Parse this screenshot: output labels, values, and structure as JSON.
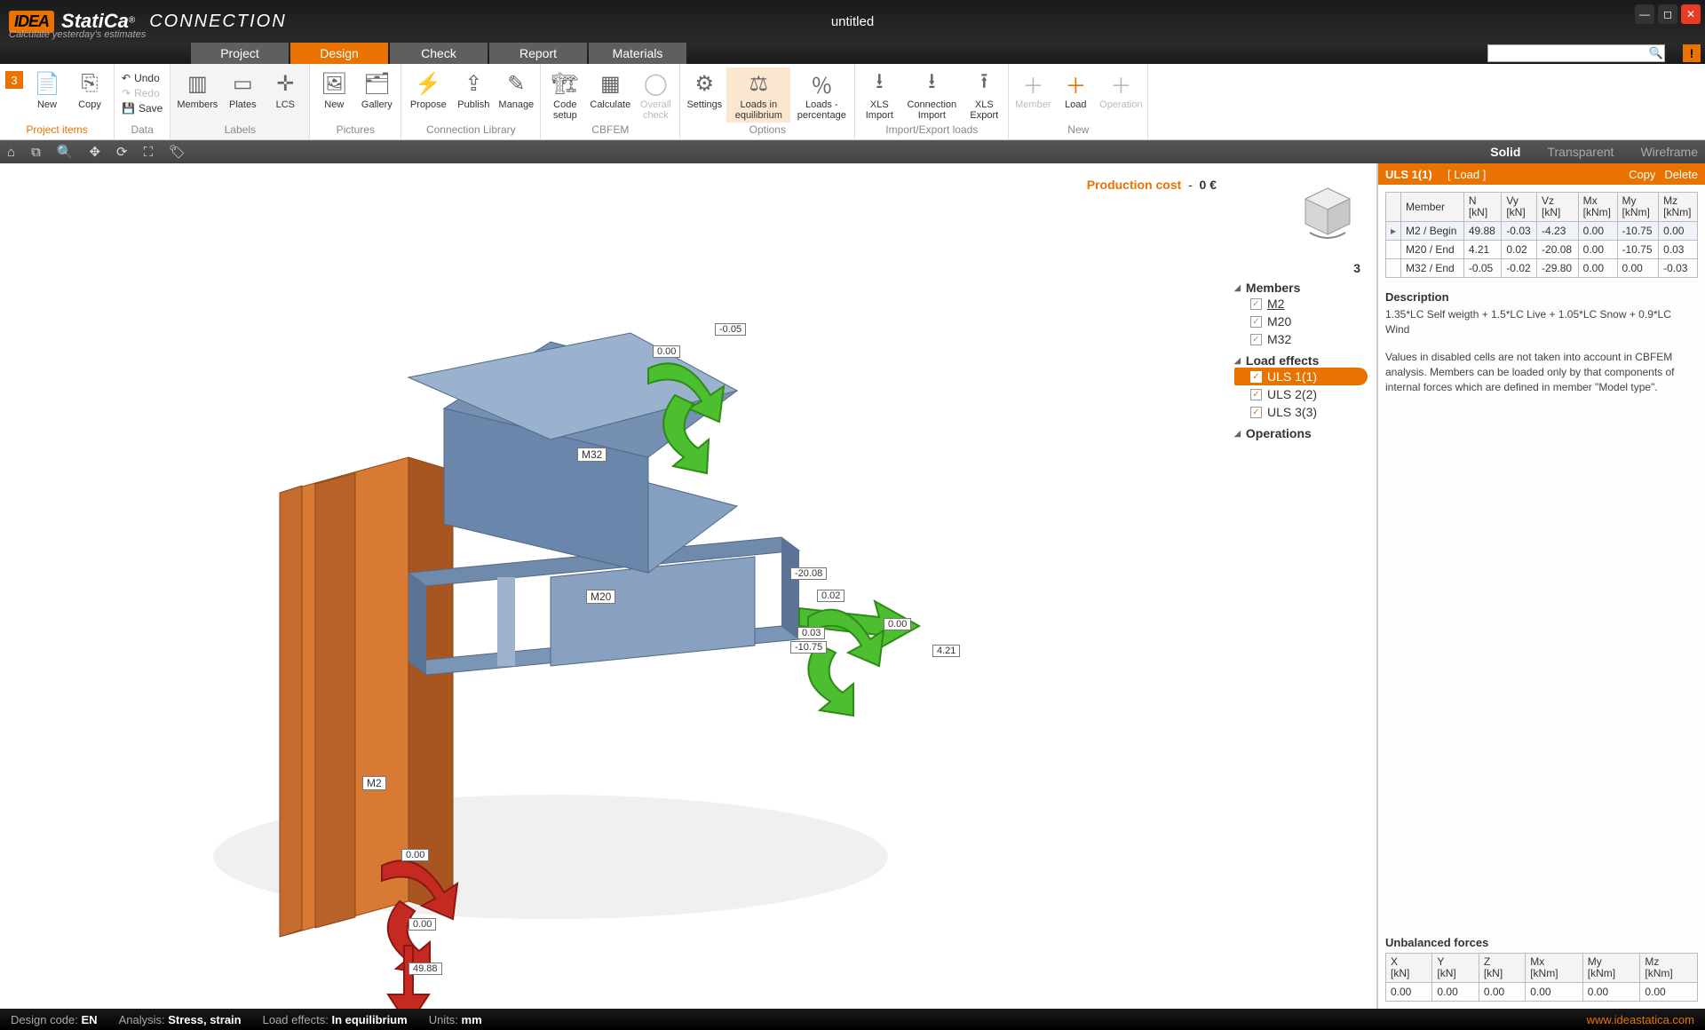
{
  "app": {
    "brand_idea": "IDEA",
    "brand_statica": "StatiCa",
    "brand_reg": "®",
    "brand_conn": "CONNECTION",
    "tagline": "Calculate yesterday's estimates",
    "doc_title": "untitled"
  },
  "tabs": {
    "project": "Project",
    "design": "Design",
    "check": "Check",
    "report": "Report",
    "materials": "Materials"
  },
  "search": {
    "placeholder": ""
  },
  "ribbon": {
    "project_num": "3",
    "new": "New",
    "copy": "Copy",
    "undo": "Undo",
    "redo": "Redo",
    "save": "Save",
    "members": "Members",
    "plates": "Plates",
    "lcs": "LCS",
    "pic_new": "New",
    "gallery": "Gallery",
    "propose": "Propose",
    "publish": "Publish",
    "manage": "Manage",
    "code_setup": "Code\nsetup",
    "calculate": "Calculate",
    "overall_check": "Overall\ncheck",
    "settings": "Settings",
    "loads_eq": "Loads in\nequilibrium",
    "loads_pct": "Loads -\npercentage",
    "xls_import": "XLS\nImport",
    "conn_import": "Connection\nImport",
    "xls_export": "XLS\nExport",
    "n_member": "Member",
    "n_load": "Load",
    "n_operation": "Operation",
    "g_project": "Project items",
    "g_data": "Data",
    "g_labels": "Labels",
    "g_pictures": "Pictures",
    "g_connlib": "Connection Library",
    "g_cbfem": "CBFEM",
    "g_options": "Options",
    "g_impexp": "Import/Export loads",
    "g_new": "New"
  },
  "viewmodes": {
    "solid": "Solid",
    "transparent": "Transparent",
    "wireframe": "Wireframe"
  },
  "viewport": {
    "prod_cost_label": "Production cost",
    "prod_cost_sep": "-",
    "prod_cost_val": "0 €",
    "labels": {
      "m2": "M2",
      "m20": "M20",
      "m32": "M32",
      "v_m005": "-0.05",
      "v_000a": "0.00",
      "v_m2008": "-20.08",
      "v_002": "0.02",
      "v_003": "0.03",
      "v_m1075": "-10.75",
      "v_000b": "0.00",
      "v_421": "4.21",
      "v_000c": "0.00",
      "v_000d": "0.00",
      "v_4988": "49.88"
    }
  },
  "tree": {
    "count": "3",
    "cat_members": "Members",
    "m2": "M2",
    "m20": "M20",
    "m32": "M32",
    "cat_load": "Load effects",
    "uls1": "ULS 1(1)",
    "uls2": "ULS 2(2)",
    "uls3": "ULS 3(3)",
    "cat_ops": "Operations"
  },
  "rp": {
    "title": "ULS 1(1)",
    "subtitle": "[ Load ]",
    "copy": "Copy",
    "delete": "Delete",
    "headers": {
      "member": "Member",
      "n": "N\n[kN]",
      "vy": "Vy\n[kN]",
      "vz": "Vz\n[kN]",
      "mx": "Mx\n[kNm]",
      "my": "My\n[kNm]",
      "mz": "Mz\n[kNm]"
    },
    "rows": [
      {
        "member": "M2 / Begin",
        "n": "49.88",
        "vy": "-0.03",
        "vz": "-4.23",
        "mx": "0.00",
        "my": "-10.75",
        "mz": "0.00"
      },
      {
        "member": "M20 / End",
        "n": "4.21",
        "vy": "0.02",
        "vz": "-20.08",
        "mx": "0.00",
        "my": "-10.75",
        "mz": "0.03"
      },
      {
        "member": "M32 / End",
        "n": "-0.05",
        "vy": "-0.02",
        "vz": "-29.80",
        "mx": "0.00",
        "my": "0.00",
        "mz": "-0.03"
      }
    ],
    "desc_title": "Description",
    "desc_text": "1.35*LC Self weigth + 1.5*LC Live + 1.05*LC Snow + 0.9*LC Wind",
    "note": "Values in disabled cells are not taken into account in CBFEM analysis. Members can be loaded only by that components of internal forces which are defined in member \"Model type\".",
    "unbal_title": "Unbalanced forces",
    "unbal_headers": {
      "x": "X\n[kN]",
      "y": "Y\n[kN]",
      "z": "Z\n[kN]",
      "mx": "Mx\n[kNm]",
      "my": "My\n[kNm]",
      "mz": "Mz\n[kNm]"
    },
    "unbal_row": {
      "x": "0.00",
      "y": "0.00",
      "z": "0.00",
      "mx": "0.00",
      "my": "0.00",
      "mz": "0.00"
    }
  },
  "status": {
    "design_code_l": "Design code:",
    "design_code_v": "EN",
    "analysis_l": "Analysis:",
    "analysis_v": "Stress, strain",
    "loadeff_l": "Load effects:",
    "loadeff_v": "In equilibrium",
    "units_l": "Units:",
    "units_v": "mm",
    "url": "www.ideastatica.com"
  },
  "chart_data": {
    "type": "table",
    "title": "ULS 1(1) member end forces",
    "columns": [
      "Member",
      "N [kN]",
      "Vy [kN]",
      "Vz [kN]",
      "Mx [kNm]",
      "My [kNm]",
      "Mz [kNm]"
    ],
    "rows": [
      [
        "M2 / Begin",
        49.88,
        -0.03,
        -4.23,
        0.0,
        -10.75,
        0.0
      ],
      [
        "M20 / End",
        4.21,
        0.02,
        -20.08,
        0.0,
        -10.75,
        0.03
      ],
      [
        "M32 / End",
        -0.05,
        -0.02,
        -29.8,
        0.0,
        0.0,
        -0.03
      ]
    ],
    "unbalanced_forces": {
      "X_kN": 0.0,
      "Y_kN": 0.0,
      "Z_kN": 0.0,
      "Mx_kNm": 0.0,
      "My_kNm": 0.0,
      "Mz_kNm": 0.0
    }
  }
}
